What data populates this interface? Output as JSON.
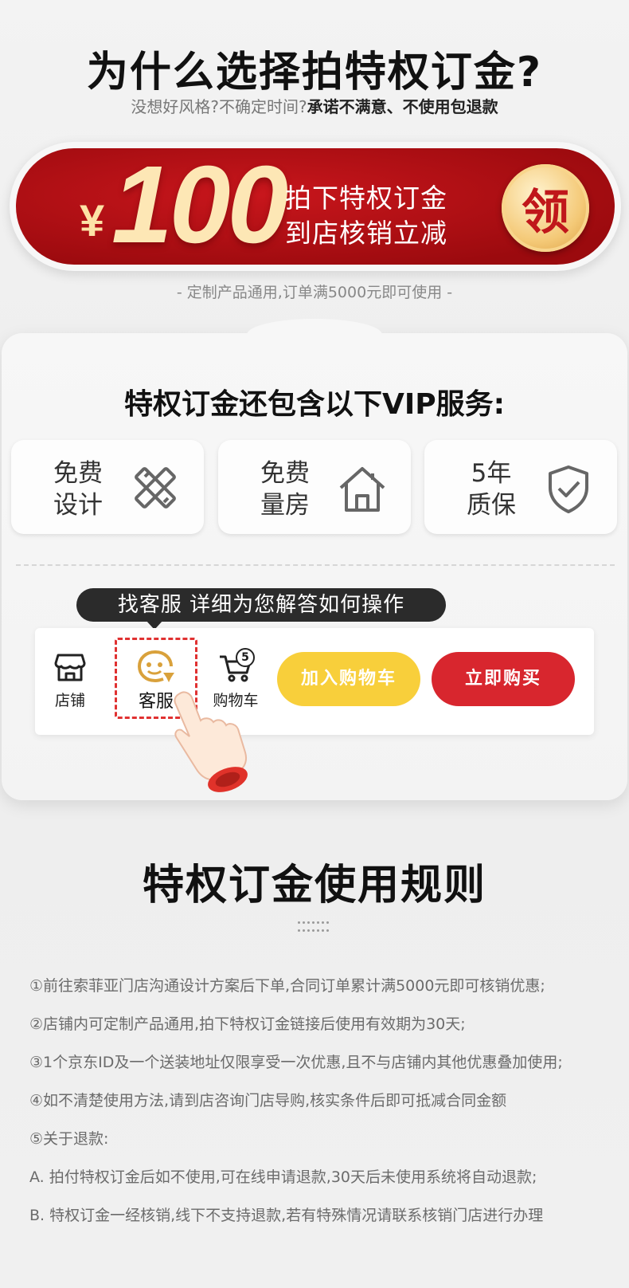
{
  "header": {
    "title": "为什么选择拍特权订金?",
    "subtitle_plain": "没想好风格?不确定时间?",
    "subtitle_bold": "承诺不满意、不使用包退款"
  },
  "banner": {
    "currency": "¥",
    "amount": "100",
    "line1": "拍下特权订金",
    "line2": "到店核销立减",
    "claim_label": "领",
    "note": "- 定制产品通用,订单满5000元即可使用 -",
    "colors": {
      "red": "#c8161c",
      "gold": "#fde7b5"
    }
  },
  "vip": {
    "title": "特权订金还包含以下VIP服务:",
    "services": [
      {
        "line1": "免费",
        "line2": "设计",
        "icon": "ruler-pencil-icon"
      },
      {
        "line1": "免费",
        "line2": "量房",
        "icon": "house-icon"
      },
      {
        "line1": "5年",
        "line2": "质保",
        "icon": "shield-check-icon"
      }
    ]
  },
  "demo_bar": {
    "tooltip": "找客服  详细为您解答如何操作",
    "store_label": "店铺",
    "service_label": "客服",
    "cart_label": "购物车",
    "cart_count": "5",
    "add_to_cart": "加入购物车",
    "buy_now": "立即购买",
    "colors": {
      "yellow": "#f8cf3b",
      "red": "#d8262e",
      "highlight": "#e03131"
    }
  },
  "rules": {
    "title": "特权订金使用规则",
    "items": [
      "①前往索菲亚门店沟通设计方案后下单,合同订单累计满5000元即可核销优惠;",
      "②店铺内可定制产品通用,拍下特权订金链接后使用有效期为30天;",
      "③1个京东ID及一个送装地址仅限享受一次优惠,且不与店铺内其他优惠叠加使用;",
      "④如不清楚使用方法,请到店咨询门店导购,核实条件后即可抵减合同金额",
      "⑤关于退款:",
      "A. 拍付特权订金后如不使用,可在线申请退款,30天后未使用系统将自动退款;",
      "B. 特权订金一经核销,线下不支持退款,若有特殊情况请联系核销门店进行办理"
    ]
  }
}
